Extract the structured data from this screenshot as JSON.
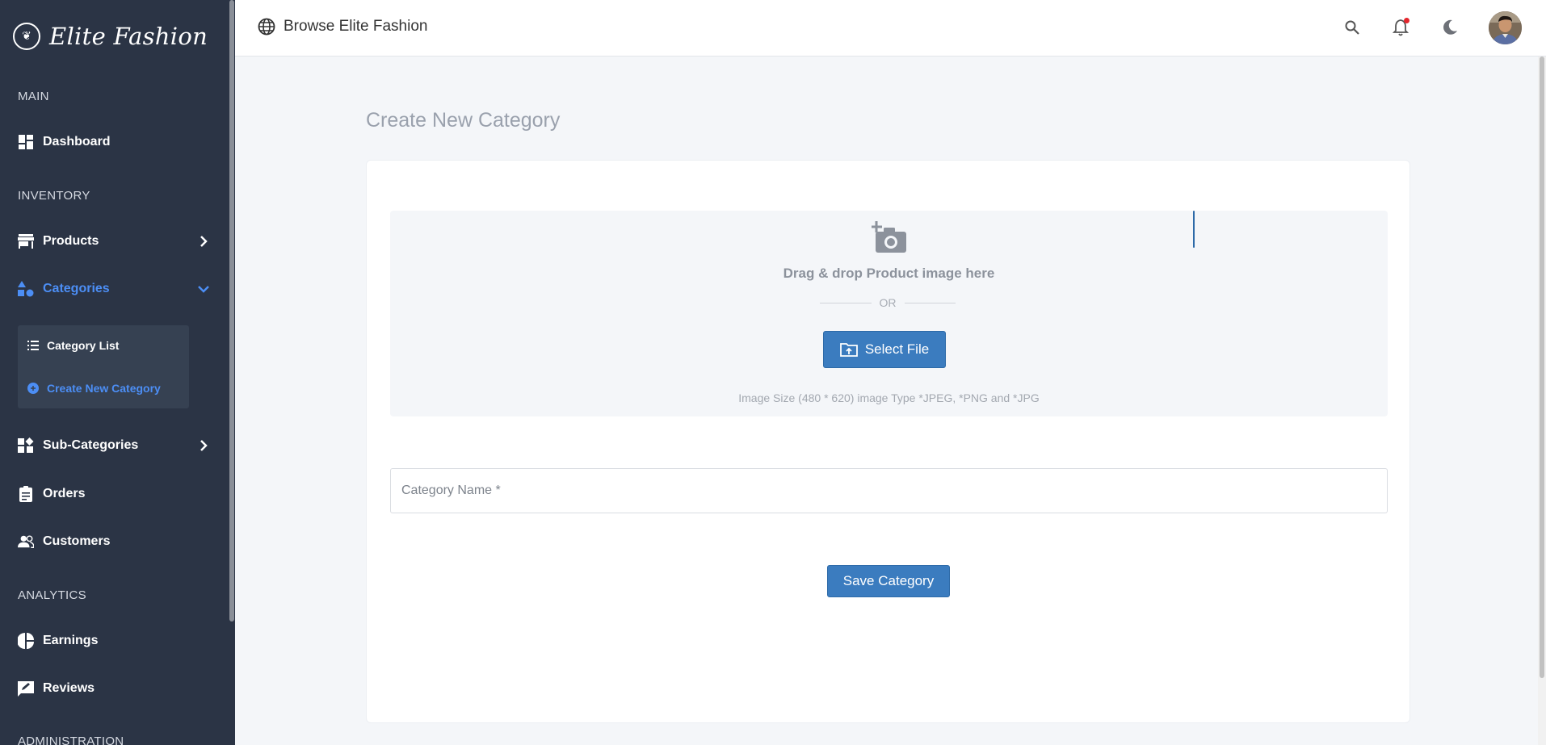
{
  "brand": {
    "name": "Elite Fashion",
    "logo_glyph": "❦"
  },
  "sidebar": {
    "sections": {
      "main": "MAIN",
      "inventory": "INVENTORY",
      "analytics": "ANALYTICS",
      "administration": "ADMINISTRATION"
    },
    "items": {
      "dashboard": "Dashboard",
      "products": "Products",
      "categories": "Categories",
      "subcategories": "Sub-Categories",
      "orders": "Orders",
      "customers": "Customers",
      "earnings": "Earnings",
      "reviews": "Reviews"
    },
    "submenu": {
      "category_list": "Category List",
      "create_category": "Create New Category"
    },
    "accent_color": "#4c8ef5"
  },
  "header": {
    "browse_label": "Browse Elite Fashion",
    "icons": [
      "globe-icon",
      "search-icon",
      "bell-icon",
      "moon-icon",
      "avatar"
    ]
  },
  "main": {
    "title": "Create New Category",
    "upload": {
      "drop_text": "Drag & drop Product image here",
      "or_text": "OR",
      "select_label": "Select File",
      "hint": "Image Size (480 * 620) image Type *JPEG, *PNG and *JPG"
    },
    "category_name": {
      "placeholder": "Category Name *",
      "value": ""
    },
    "save_label": "Save Category",
    "button_color": "#3b7cbf"
  }
}
